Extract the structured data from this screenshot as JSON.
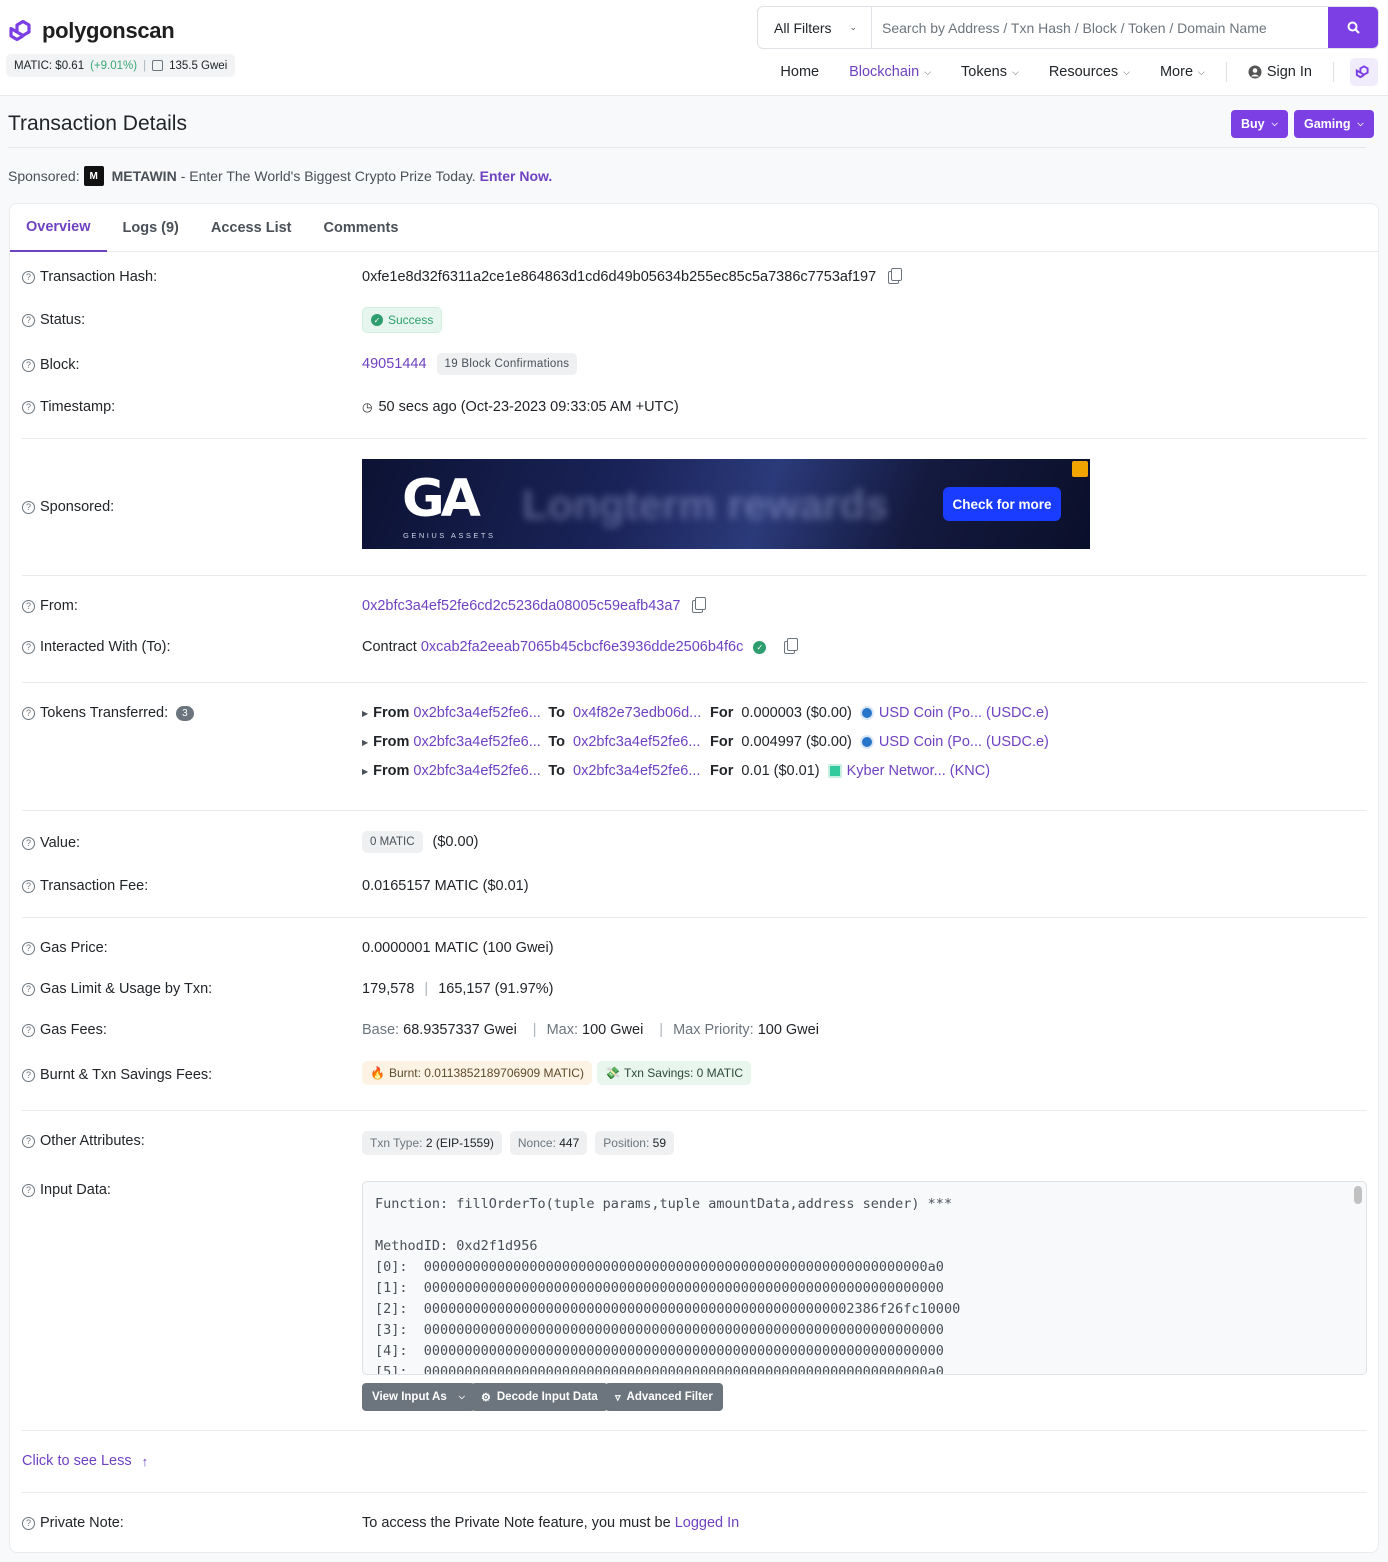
{
  "brand": {
    "name": "polygonscan"
  },
  "ticker": {
    "price": "MATIC: $0.61",
    "change": "(+9.01%)",
    "gas": "135.5 Gwei"
  },
  "search": {
    "filter": "All Filters",
    "placeholder": "Search by Address / Txn Hash / Block / Token / Domain Name"
  },
  "nav": {
    "home": "Home",
    "blockchain": "Blockchain",
    "tokens": "Tokens",
    "resources": "Resources",
    "more": "More",
    "signin": "Sign In"
  },
  "page": {
    "title": "Transaction Details",
    "buy": "Buy",
    "gaming": "Gaming"
  },
  "sponsor": {
    "label": "Sponsored:",
    "brand": "METAWIN",
    "text": "- Enter The World's Biggest Crypto Prize Today.",
    "cta": "Enter Now."
  },
  "tabs": [
    "Overview",
    "Logs (9)",
    "Access List",
    "Comments"
  ],
  "labels": {
    "hash": "Transaction Hash:",
    "status": "Status:",
    "block": "Block:",
    "timestamp": "Timestamp:",
    "sponsored": "Sponsored:",
    "from": "From:",
    "to": "Interacted With (To):",
    "tokens": "Tokens Transferred:",
    "value": "Value:",
    "fee": "Transaction Fee:",
    "gas_price": "Gas Price:",
    "gas_limit": "Gas Limit & Usage by Txn:",
    "gas_fees": "Gas Fees:",
    "burnt": "Burnt & Txn Savings Fees:",
    "other": "Other Attributes:",
    "input": "Input Data:",
    "private": "Private Note:"
  },
  "tx": {
    "hash": "0xfe1e8d32f6311a2ce1e864863d1cd6d49b05634b255ec85c5a7386c7753af197",
    "status": "Success",
    "block": "49051444",
    "confirmations": "19 Block Confirmations",
    "timestamp": "50 secs ago (Oct-23-2023 09:33:05 AM +UTC)",
    "from": "0x2bfc3a4ef52fe6cd2c5236da08005c59eafb43a7",
    "to_prefix": "Contract",
    "to": "0xcab2fa2eeab7065b45cbcf6e3936dde2506b4f6c",
    "token_count": "3",
    "transfers": [
      {
        "from_lbl": "From",
        "from": "0x2bfc3a4ef52fe6...",
        "to_lbl": "To",
        "to": "0x4f82e73edb06d...",
        "for_lbl": "For",
        "amount": "0.000003 ($0.00)",
        "token": "USD Coin (Po... (USDC.e)",
        "icon": "usdc-icon"
      },
      {
        "from_lbl": "From",
        "from": "0x2bfc3a4ef52fe6...",
        "to_lbl": "To",
        "to": "0x2bfc3a4ef52fe6...",
        "for_lbl": "For",
        "amount": "0.004997 ($0.00)",
        "token": "USD Coin (Po... (USDC.e)",
        "icon": "usdc-icon"
      },
      {
        "from_lbl": "From",
        "from": "0x2bfc3a4ef52fe6...",
        "to_lbl": "To",
        "to": "0x2bfc3a4ef52fe6...",
        "for_lbl": "For",
        "amount": "0.01 ($0.01)",
        "token": "Kyber Networ... (KNC)",
        "icon": "knc-icon"
      }
    ],
    "value_badge": "0 MATIC",
    "value_usd": "($0.00)",
    "fee": "0.0165157 MATIC ($0.01)",
    "gas_price": "0.0000001 MATIC (100 Gwei)",
    "gas_limit": "179,578",
    "gas_used": "165,157 (91.97%)",
    "gas_base_lbl": "Base:",
    "gas_base": "68.9357337 Gwei",
    "gas_max_lbl": "Max:",
    "gas_max": "100 Gwei",
    "gas_prio_lbl": "Max Priority:",
    "gas_prio": "100 Gwei",
    "burnt": "Burnt: 0.0113852189706909 MATIC)",
    "savings": "Txn Savings: 0 MATIC",
    "txn_type_lbl": "Txn Type:",
    "txn_type": "2 (EIP-1559)",
    "nonce_lbl": "Nonce:",
    "nonce": "447",
    "position_lbl": "Position:",
    "position": "59",
    "input": "Function: fillOrderTo(tuple params,tuple amountData,address sender) ***\n\nMethodID: 0xd2f1d956\n[0]:  00000000000000000000000000000000000000000000000000000000000000a0\n[1]:  0000000000000000000000000000000000000000000000000000000000000000\n[2]:  00000000000000000000000000000000000000000000000000002386f26fc10000\n[3]:  0000000000000000000000000000000000000000000000000000000000000000\n[4]:  0000000000000000000000000000000000000000000000000000000000000000\n[5]:  00000000000000000000000000000000000000000000000000000000000000a0",
    "view_input": "View Input As",
    "decode": "Decode Input Data",
    "adv_filter": "Advanced Filter",
    "see_less": "Click to see Less",
    "private_text": "To access the Private Note feature, you must be",
    "logged_in": "Logged In"
  },
  "ad": {
    "brand": "GA",
    "sub": "GENIUS ASSETS",
    "blurred": "Longterm rewards",
    "cta": "Check for more"
  },
  "colors": {
    "accent": "#7b3fe4",
    "link": "#6f42c1",
    "success": "#2e9e6e"
  }
}
